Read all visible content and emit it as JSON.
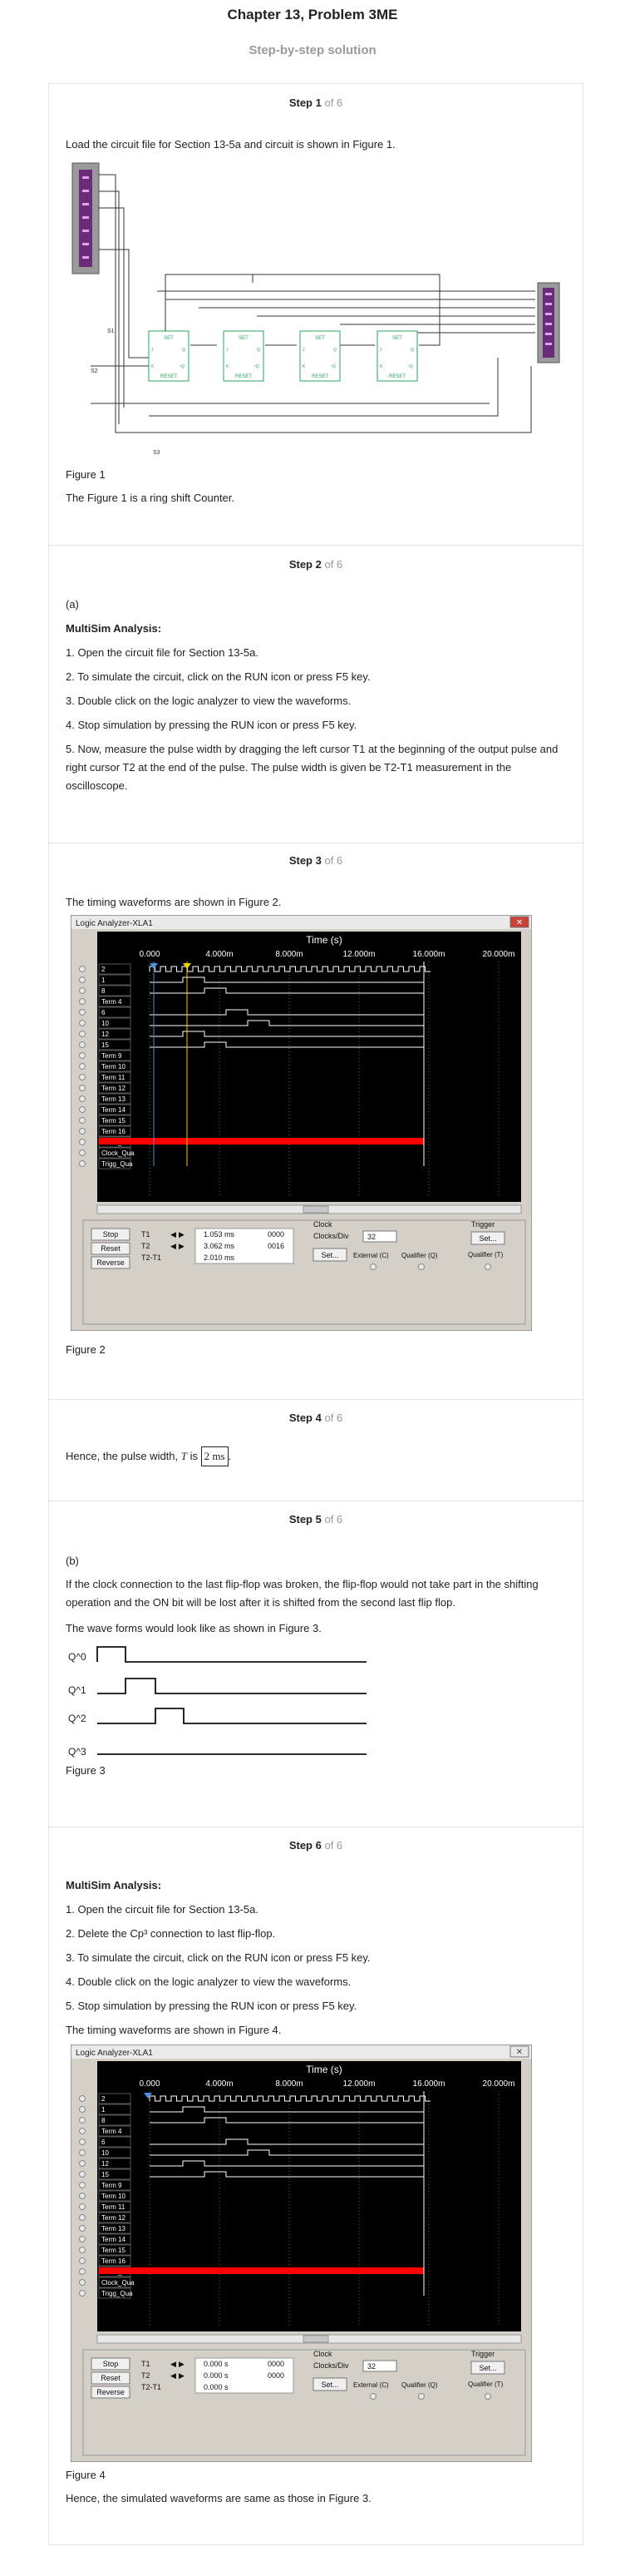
{
  "header": {
    "title": "Chapter 13, Problem 3ME",
    "subtitle": "Step-by-step solution"
  },
  "steps": [
    {
      "label": "Step 1",
      "of": "of 6",
      "text1": "Load the circuit file for Section 13-5a and circuit is shown in Figure 1.",
      "caption": "Figure 1",
      "text2": "The Figure 1 is a ring shift Counter.",
      "circuit": {
        "flipflop_top": "SET",
        "flipflop_bottom": "RESET",
        "pins": [
          "J",
          "K",
          "Q",
          "~Q"
        ],
        "wire_labels": [
          "S1",
          "S2",
          "S3"
        ]
      }
    },
    {
      "label": "Step 2",
      "of": "of 6",
      "part": "(a)",
      "heading": "MultiSim Analysis:",
      "items": [
        "1. Open the circuit file for Section 13-5a.",
        "2. To simulate the circuit, click on the RUN icon or press F5 key.",
        "3. Double click on the logic analyzer to view the waveforms.",
        "4. Stop simulation by pressing the RUN icon or press F5 key.",
        "5. Now, measure the pulse width by dragging the left cursor T1 at the beginning of the output pulse and right cursor T2 at the end of the pulse. The pulse width is given be T2-T1 measurement in the oscilloscope."
      ]
    },
    {
      "label": "Step 3",
      "of": "of 6",
      "text": "The timing waveforms are shown in Figure 2.",
      "caption": "Figure 2"
    },
    {
      "label": "Step 4",
      "of": "of 6",
      "text_pre": "Hence, the pulse width,",
      "symbol": "T",
      "text_is": "is",
      "value": "2 ms"
    },
    {
      "label": "Step 5",
      "of": "of 6",
      "part": "(b)",
      "text1": "If the clock connection to the last flip-flop was broken, the flip-flop would not take part in the shifting operation and the ON bit will be lost after it is shifted from the second last flip flop.",
      "text2": "The wave forms would look like as shown in Figure 3.",
      "wave_labels": [
        "Q^0",
        "Q^1",
        "Q^2",
        "Q^3"
      ],
      "caption": "Figure 3"
    },
    {
      "label": "Step 6",
      "of": "of 6",
      "heading": "MultiSim Analysis:",
      "items": [
        "1. Open the circuit file for Section 13-5a.",
        "2. Delete the Cp³ connection to last flip-flop.",
        "3. To simulate the circuit, click on the RUN icon or press F5 key.",
        "4. Double click on the logic analyzer to view the waveforms.",
        "5. Stop simulation by pressing the RUN icon or press F5 key."
      ],
      "text": "The timing waveforms are shown in Figure 4.",
      "caption": "Figure 4",
      "text_end": "Hence, the simulated waveforms are same as those in Figure 3."
    }
  ],
  "analyzer_fig2": {
    "window_title": "Logic Analyzer-XLA1",
    "time_title": "Time (s)",
    "time_ticks": [
      "0.000",
      "4.000m",
      "8.000m",
      "12.000m",
      "16.000m",
      "20.000m"
    ],
    "channels": [
      "2",
      "1",
      "8",
      "Term 4",
      "6",
      "10",
      "12",
      "15",
      "Term 9",
      "Term 10",
      "Term 11",
      "Term 12",
      "Term 13",
      "Term 14",
      "Term 15",
      "Term 16",
      "Clock_Int",
      "Clock_Qua",
      "Trigg_Qua"
    ],
    "buttons": [
      "Stop",
      "Reset",
      "Reverse"
    ],
    "cursors": [
      {
        "label": "T1",
        "time": "1.053 ms",
        "value": "0000"
      },
      {
        "label": "T2",
        "time": "3.062 ms",
        "value": "0016"
      },
      {
        "label": "T2-T1",
        "time": "2.010 ms",
        "value": ""
      }
    ],
    "clock_label": "Clock",
    "clocks_div_label": "Clocks/Div",
    "clocks_div": "32",
    "clock_set": "Set...",
    "clock_options": [
      "External (C)",
      "Qualifier (Q)"
    ],
    "trigger_label": "Trigger",
    "trigger_set": "Set...",
    "trigger_qualifier": "Qualifier (T)"
  },
  "analyzer_fig4": {
    "window_title": "Logic Analyzer-XLA1",
    "time_title": "Time (s)",
    "time_ticks": [
      "0.000",
      "4.000m",
      "8.000m",
      "12.000m",
      "16.000m",
      "20.000m"
    ],
    "channels": [
      "2",
      "1",
      "8",
      "Term 4",
      "6",
      "10",
      "12",
      "15",
      "Term 9",
      "Term 10",
      "Term 11",
      "Term 12",
      "Term 13",
      "Term 14",
      "Term 15",
      "Term 16",
      "Clock_Int",
      "Clock_Qua",
      "Trigg_Qua"
    ],
    "buttons": [
      "Stop",
      "Reset",
      "Reverse"
    ],
    "cursors": [
      {
        "label": "T1",
        "time": "0.000 s",
        "value": "0000"
      },
      {
        "label": "T2",
        "time": "0.000 s",
        "value": "0000"
      },
      {
        "label": "T2-T1",
        "time": "0.000 s",
        "value": ""
      }
    ],
    "clock_label": "Clock",
    "clocks_div_label": "Clocks/Div",
    "clocks_div": "32",
    "clock_set": "Set...",
    "clock_options": [
      "External (C)",
      "Qualifier (Q)"
    ],
    "trigger_label": "Trigger",
    "trigger_set": "Set...",
    "trigger_qualifier": "Qualifier (T)"
  },
  "colors": {
    "accent_red": "#ff0000",
    "screen_bg": "#000000",
    "trace": "#ffffff",
    "cursor_yellow": "#e6d200",
    "cursor_blue": "#4a90e2",
    "component_green": "#2aa55a",
    "probe_purple": "#6a2b7a"
  }
}
